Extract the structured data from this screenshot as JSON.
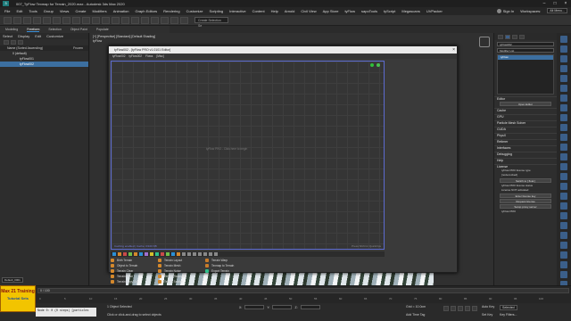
{
  "window": {
    "title": "007_TyFlow Texmap for Terrain_2020.max - Autodesk 3ds Max 2020",
    "workspace_label": "Workspaces:",
    "workspace_value": "Alt Menu...",
    "signin_label": "Sign In",
    "icon": "app-icon"
  },
  "menus": [
    "File",
    "Edit",
    "Tools",
    "Group",
    "Views",
    "Create",
    "Modifiers",
    "Animation",
    "Graph Editors",
    "Rendering",
    "Customize",
    "Scripting",
    "Interactive",
    "Content",
    "Help",
    "Arnold",
    "Civil View",
    "App Store",
    "tyFlow",
    "sapoTools",
    "tyScript",
    "Megascans",
    "UVPacker"
  ],
  "toolbar": {
    "selection_set_placeholder": "Create Selection Se"
  },
  "ribbon": {
    "tabs": [
      "Modeling",
      "Freeform",
      "Selection",
      "Object Paint",
      "Populate"
    ],
    "active": "Freeform"
  },
  "scene_explorer": {
    "tabs": [
      "Select",
      "Display",
      "Edit",
      "Customize"
    ],
    "column_header": "Name (Sorted Ascending)",
    "frozen_label": "Frozen",
    "items": [
      "0 (default)",
      "tyFlow001",
      "tyFlow002"
    ],
    "layer_label": "Default_0001"
  },
  "viewport": {
    "label": "[+] [Perspective] [Standard] [Default Shading]",
    "corner_label": "tyFlow"
  },
  "editor": {
    "title": "tyFlow002 - [tyFlow PRO v1.0101 Editor]",
    "menu": [
      "tyFlow002",
      "tyFlow002",
      "Flows",
      "[Misc]"
    ],
    "hint": "tyFlow PRO - Click here to begin",
    "status_left": "Caching enabled | Cache: 0/100 KB",
    "status_right": "Press Shift for QuickOps"
  },
  "depot": {
    "col1": [
      "Birth Terrain",
      "Object to Terrain",
      "Terrain Clear",
      "Terrain Color",
      "Terrain Copy Out",
      "Terrain Display",
      "Terrain Erosion",
      "Terrain Filter",
      "Terrain Fill"
    ],
    "col2": [
      "Terrain Layout",
      "Terrain Mesh",
      "Terrain Noise",
      "Terrain Resample",
      "Terrain Scatter",
      "Terrain Slope",
      "Terrain Snow",
      "Terrain Tile",
      "Terrain Transform"
    ],
    "col3": [
      "Terrain Warp",
      "Texmap to Terrain",
      "Export Terrain"
    ],
    "colors": {
      "col1": "#d4882c",
      "col2": "#d4882c",
      "col3": "#c87b2a",
      "export": "#2fbf8a"
    }
  },
  "command_panel": {
    "object_name": "tyFlow002",
    "modifier_list": "Modifier List",
    "stack_item": "tyFlow",
    "sections": [
      "Editor",
      "Cache",
      "GPU",
      "Particle Mesh Solver",
      "CUDA",
      "PhysX",
      "Retimer",
      "Interfaces",
      "Debugging",
      "Help",
      "License"
    ],
    "editor_button": "Open Editor",
    "license_lines": [
      "tyFlow PRO license type",
      "[node-locked]",
      "Switch to [ float ]",
      "tyFlow PRO license status",
      "License NOT activated",
      "Enter license key",
      "Request license",
      "Setup proxy server",
      "tyFlow PRO"
    ],
    "license_buttons": [
      "Switch to [ float ]",
      "Enter license key",
      "Request license",
      "Setup proxy server"
    ]
  },
  "timeline": {
    "frame": "0 / 100",
    "ticks": [
      "0",
      "5",
      "10",
      "15",
      "20",
      "25",
      "30",
      "35",
      "40",
      "45",
      "50",
      "55",
      "60",
      "65",
      "70",
      "75",
      "80",
      "85",
      "90",
      "95",
      "100"
    ]
  },
  "status": {
    "selected": "1 Object Selected",
    "prompt": "Click or click-and-drag to select objects",
    "maxscript": "Node 0: 0 (0 steps) [particles",
    "x_label": "X:",
    "y_label": "Y:",
    "z_label": "Z:",
    "grid": "Grid = 10.0cm",
    "add_time_tag": "Add Time Tag",
    "auto_key": "Auto Key",
    "selected_btn": "Selected",
    "set_key": "Set Key",
    "key_filters": "Key Filters..."
  },
  "banner": {
    "line1": "Max 21 Training",
    "line2": "Tuturial Sets"
  }
}
